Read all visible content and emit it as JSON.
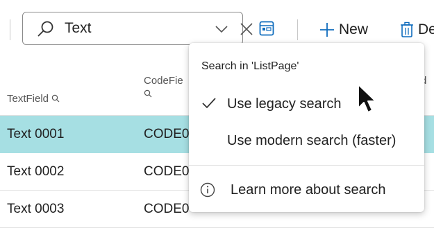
{
  "toolbar": {
    "search": {
      "value": "Text",
      "placeholder": ""
    },
    "new_label": "New",
    "delete_label": "De"
  },
  "icons": {
    "search": "search-icon",
    "dropdown": "chevron-down-icon",
    "clear": "close-icon",
    "layout": "layout-icon",
    "new": "plus-icon",
    "delete": "trash-icon",
    "check": "checkmark-icon",
    "info": "info-icon",
    "pointer": "mouse-pointer-icon"
  },
  "grid": {
    "columns": [
      "TextField 🔍",
      "CodeFie",
      "🔍",
      "d"
    ],
    "col1_header": "TextField",
    "col2_header_line1": "CodeFie",
    "col3_header_partial": "d",
    "rows": [
      {
        "text": "Text 0001",
        "code": "CODE0",
        "selected": true
      },
      {
        "text": "Text 0002",
        "code": "CODE0",
        "selected": false
      },
      {
        "text": "Text 0003",
        "code": "CODE0",
        "selected": false
      }
    ]
  },
  "search_popup": {
    "title": "Search in 'ListPage'",
    "options": [
      {
        "label": "Use legacy search",
        "checked": true
      },
      {
        "label": "Use modern search (faster)",
        "checked": false
      }
    ],
    "learn_more": "Learn more about search"
  },
  "colors": {
    "selected_row": "#a6dfe3",
    "accent": "#0f6cbd",
    "text": "#212121"
  }
}
